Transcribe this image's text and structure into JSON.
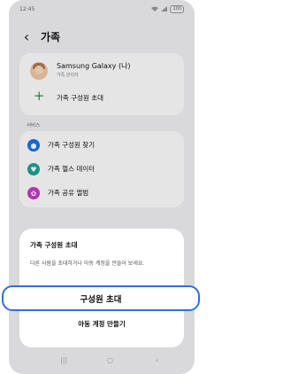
{
  "status": {
    "time": "12:45",
    "battery": "100",
    "signal_icon": "signal-icon",
    "wifi_icon": "wifi-icon"
  },
  "appbar": {
    "title": "가족",
    "back_icon": "back-icon"
  },
  "user": {
    "name": "Samsung Galaxy (나)",
    "role": "가족 관리자"
  },
  "invite_row": {
    "label": "가족 구성원 초대",
    "icon": "plus-icon"
  },
  "services": {
    "header": "서비스",
    "items": [
      {
        "label": "가족 구성원 찾기",
        "icon": "location-pin-icon",
        "color": "#1a73e8"
      },
      {
        "label": "가족 헬스 데이터",
        "icon": "health-icon",
        "color": "#1aa597"
      },
      {
        "label": "가족 공유 앨범",
        "icon": "album-icon",
        "color": "#c53cc9"
      }
    ]
  },
  "sheet": {
    "title": "가족 구성원 초대",
    "description": "다른 사람을 초대하거나 아동 계정을 만들어 보세요.",
    "primary": "구성원 초대",
    "secondary": "아동 계정 만들기"
  },
  "navbar": {
    "recents": "|||",
    "home": "○",
    "back": "‹"
  },
  "colors": {
    "accent": "#2f6fe0",
    "green": "#2a9a4a"
  }
}
